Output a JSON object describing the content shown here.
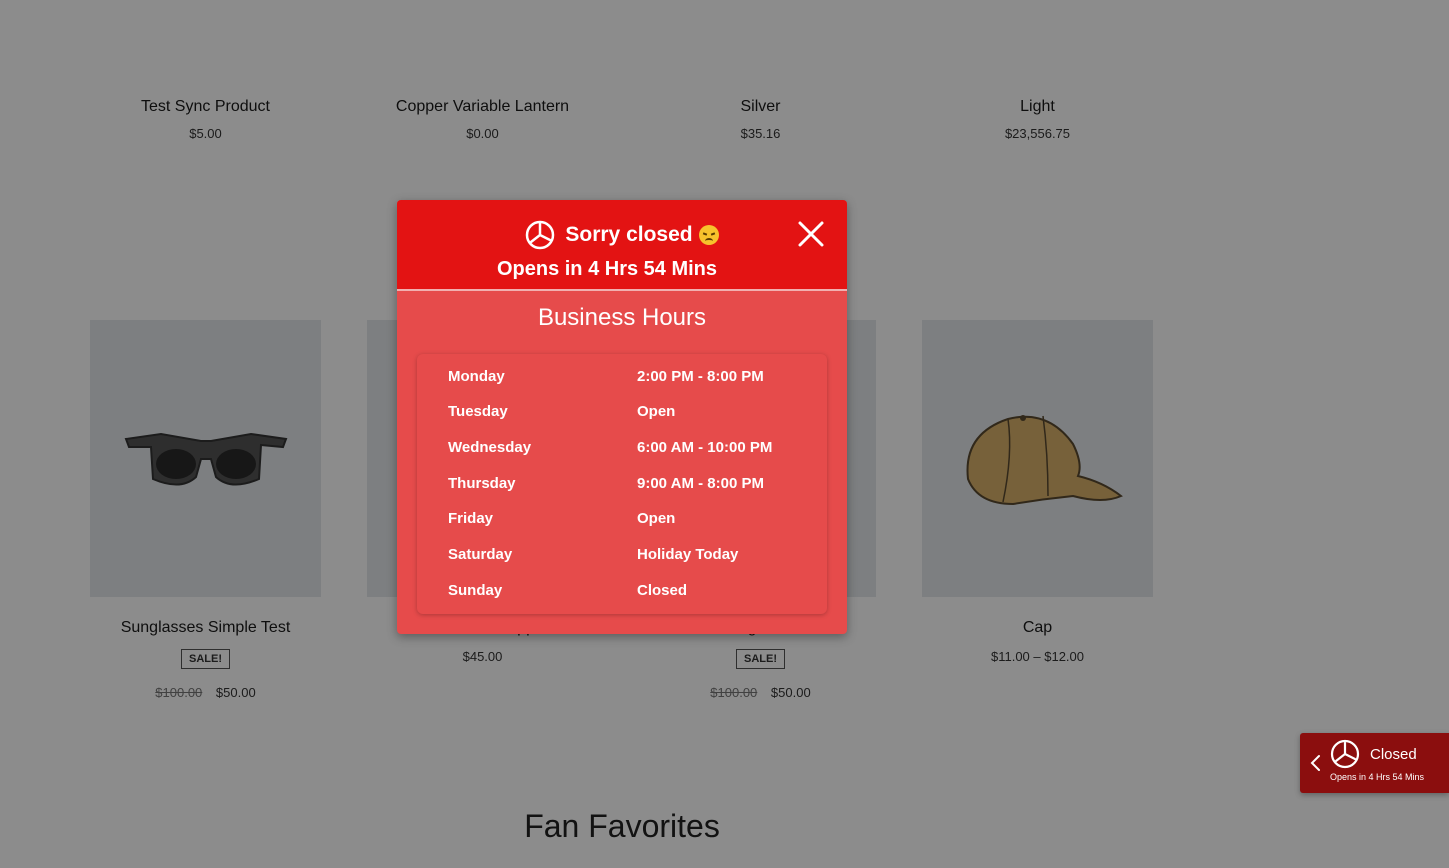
{
  "products_top": [
    {
      "name": "Test Sync Product",
      "price": "$5.00"
    },
    {
      "name": "Copper Variable Lantern",
      "price": "$0.00"
    },
    {
      "name": "Silver",
      "price": "$35.16"
    },
    {
      "name": "Light",
      "price": "$23,556.75"
    }
  ],
  "products_bottom": [
    {
      "name": "Sunglasses Simple Test",
      "badge": "SALE!",
      "old_price": "$100.00",
      "price": "$50.00"
    },
    {
      "name": "Hoodie with Zipper",
      "price": "$45.00"
    },
    {
      "name": "Sunglasses",
      "badge": "SALE!",
      "old_price": "$100.00",
      "price": "$50.00"
    },
    {
      "name": "Cap",
      "price": "$11.00 – $12.00"
    }
  ],
  "section_title": "Fan Favorites",
  "modal": {
    "title": "Sorry closed",
    "subtitle": "Opens in 4 Hrs 54 Mins",
    "hours_title": "Business Hours",
    "hours": [
      {
        "day": "Monday",
        "time": "2:00 PM - 8:00 PM"
      },
      {
        "day": "Tuesday",
        "time": "Open"
      },
      {
        "day": "Wednesday",
        "time": "6:00 AM - 10:00 PM"
      },
      {
        "day": "Thursday",
        "time": "9:00 AM - 8:00 PM"
      },
      {
        "day": "Friday",
        "time": "Open"
      },
      {
        "day": "Saturday",
        "time": "Holiday Today"
      },
      {
        "day": "Sunday",
        "time": "Closed"
      }
    ]
  },
  "side_widget": {
    "status": "Closed",
    "subtitle": "Opens in 4 Hrs 54 Mins"
  },
  "colors": {
    "header_red": "#e31313",
    "modal_red": "#e64b4b",
    "widget_dark_red": "#8b0e0e"
  },
  "icons": [
    "clock-icon",
    "close-icon",
    "sad-face-emoji",
    "chevron-left-icon"
  ]
}
